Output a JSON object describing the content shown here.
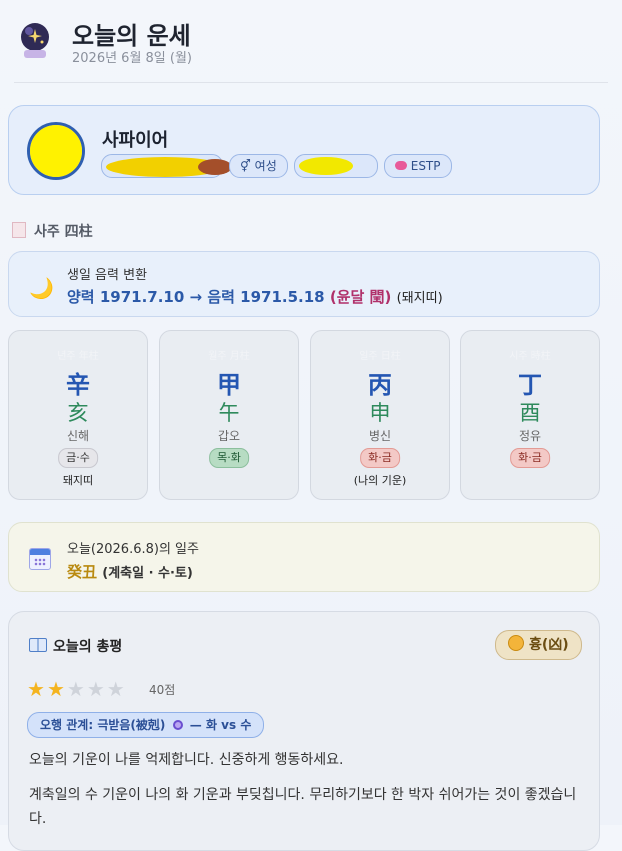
{
  "header": {
    "icon": "crystal-ball-icon",
    "title": "오늘의 운세",
    "date": "2026년 6월 8일 (월)"
  },
  "profile": {
    "name": "사파이어",
    "chips": [
      {
        "icon": "redacted",
        "label": ""
      },
      {
        "icon": "gender-icon",
        "label": "⚥ 여성"
      },
      {
        "icon": "redacted",
        "label": ""
      },
      {
        "icon": "brain-icon",
        "label": "ESTP"
      }
    ]
  },
  "saju": {
    "title": "사주 四柱",
    "icon": "saju-icon"
  },
  "lunar": {
    "caption": "생일 음력 변환",
    "solar": "양력 1971.7.10",
    "arrow": "→",
    "lunar": "음력 1971.5.18",
    "leap": "(윤달 閏)",
    "zodiac": "(돼지띠)"
  },
  "pillars": [
    {
      "label": "년주 年柱",
      "stem": "辛",
      "branch": "亥",
      "korean": "신해",
      "element": "금·수",
      "element_style": "metal-water",
      "note": "돼지띠"
    },
    {
      "label": "월주 月柱",
      "stem": "甲",
      "branch": "午",
      "korean": "갑오",
      "element": "목·화",
      "element_style": "wood-fire",
      "note": ""
    },
    {
      "label": "일주 日柱",
      "stem": "丙",
      "branch": "申",
      "korean": "병신",
      "element": "화·금",
      "element_style": "fire-metal",
      "note": "(나의 기운)"
    },
    {
      "label": "시주 時柱",
      "stem": "丁",
      "branch": "酉",
      "korean": "정유",
      "element": "화·금",
      "element_style": "fire-metal",
      "note": ""
    }
  ],
  "today": {
    "caption": "오늘(2026.6.8)의 일주",
    "ganji": "癸丑",
    "detail": "(계축일 · 수·토)"
  },
  "summary": {
    "title": "오늘의 총평",
    "badge": "흉(凶)",
    "stars_on": 2,
    "stars_total": 5,
    "score": "40점",
    "relation": "오행 관계: 극받음(被剋)",
    "relation_tail": "— 화 vs 수",
    "line1": "오늘의 기운이 나를 억제합니다. 신중하게 행동하세요.",
    "line2": "계축일의 수 기운이 나의 화 기운과 부딪칩니다. 무리하기보다 한 박자 쉬어가는 것이 좋겠습니다."
  },
  "colors": {
    "accent": "#2456b2",
    "branch": "#2e8a5c",
    "gold": "#b98a10"
  }
}
